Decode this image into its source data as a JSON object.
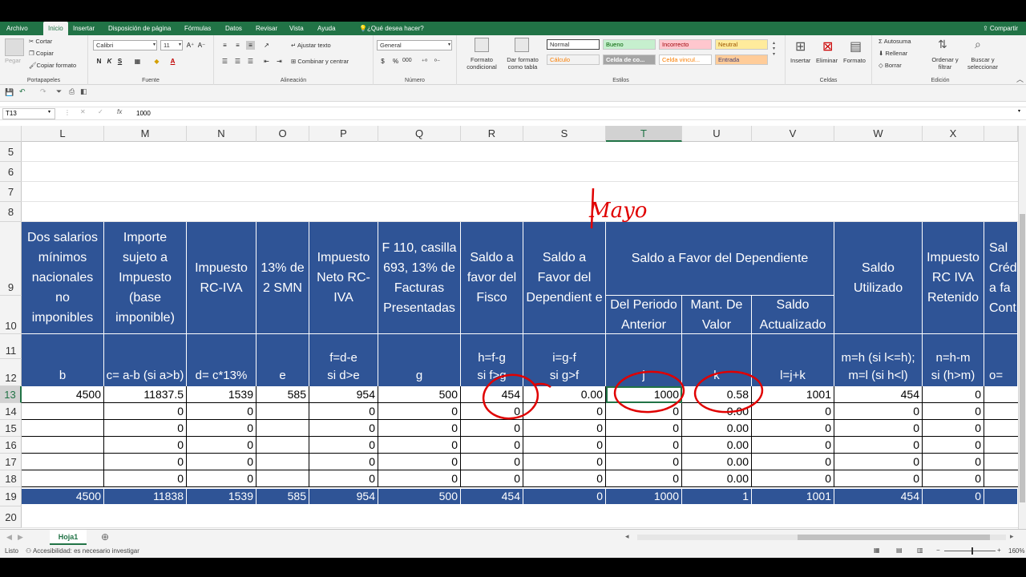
{
  "menu": {
    "tabs": [
      "Archivo",
      "Inicio",
      "Insertar",
      "Disposición de página",
      "Fórmulas",
      "Datos",
      "Revisar",
      "Vista",
      "Ayuda",
      "¿Qué desea hacer?"
    ],
    "share": "Compartir"
  },
  "ribbon": {
    "clipboard": {
      "paste": "Pegar",
      "cut": "Cortar",
      "copy": "Copiar",
      "format_painter": "Copiar formato",
      "label": "Portapapeles"
    },
    "font": {
      "name": "Calibri",
      "size": "11",
      "bold": "N",
      "italic": "K",
      "underline": "S",
      "label": "Fuente"
    },
    "alignment": {
      "wrap": "Ajustar texto",
      "merge": "Combinar y centrar",
      "label": "Alineación"
    },
    "number": {
      "format": "General",
      "label": "Número",
      "currency": "$",
      "percent": "%",
      "thousands": "000"
    },
    "styles": {
      "conditional": "Formato condicional",
      "as_table": "Dar formato como tabla",
      "cells": [
        "Normal",
        "Bueno",
        "Incorrecto",
        "Neutral",
        "Cálculo",
        "Celda de co...",
        "Celda vincul...",
        "Entrada"
      ],
      "label": "Estilos"
    },
    "cells": {
      "insert": "Insertar",
      "delete": "Eliminar",
      "format": "Formato",
      "label": "Celdas"
    },
    "editing": {
      "autosum": "Autosuma",
      "fill": "Rellenar",
      "clear": "Borrar",
      "sort": "Ordenar y filtrar",
      "find": "Buscar y seleccionar",
      "label": "Edición"
    }
  },
  "formula_bar": {
    "name_box": "T13",
    "value": "1000",
    "fx": "fx"
  },
  "columns": [
    "L",
    "M",
    "N",
    "O",
    "P",
    "Q",
    "R",
    "S",
    "T",
    "U",
    "V",
    "W",
    "X"
  ],
  "selected_column": "T",
  "rows": [
    "5",
    "6",
    "7",
    "8",
    "9",
    "10",
    "11",
    "12",
    "13",
    "14",
    "15",
    "16",
    "17",
    "18",
    "19",
    "20"
  ],
  "selected_row": "13",
  "annotation_text": "Mayo",
  "headers": {
    "L": "Dos salarios mínimos nacionales no imponibles",
    "M": "Importe sujeto a Impuesto (base imponible)",
    "N": "Impuesto RC-IVA",
    "O": "13% de 2 SMN",
    "P": "Impuesto Neto RC-IVA",
    "Q": "F 110, casilla 693, 13% de Facturas Presentadas",
    "R": "Saldo a favor del Fisco",
    "S": "Saldo a Favor del Dependient e",
    "TUV": "Saldo a Favor del Dependiente",
    "T": "Del Periodo Anterior",
    "U": "Mant. De Valor",
    "V": "Saldo Actualizado",
    "W": "Saldo Utilizado",
    "X": "Impuesto RC IVA Retenido",
    "Y": "Sal Créd a fa Cont"
  },
  "formulas": {
    "L": [
      "b"
    ],
    "M": [
      "c= a-b (si a>b)"
    ],
    "N": [
      "d= c*13%"
    ],
    "O": [
      "e"
    ],
    "P": [
      "f=d-e",
      "si d>e"
    ],
    "Q": [
      "g"
    ],
    "R": [
      "h=f-g",
      "si f>g"
    ],
    "S": [
      "i=g-f",
      "si g>f"
    ],
    "T": [
      "j"
    ],
    "U": [
      "k"
    ],
    "V": [
      "l=j+k"
    ],
    "W": [
      "m=h (si l<=h);",
      "m=l (si h<l)"
    ],
    "X": [
      "n=h-m",
      "si (h>m)"
    ],
    "Y": [
      "o="
    ]
  },
  "data_rows": [
    {
      "row": "13",
      "cells": [
        "4500",
        "11837.5",
        "1539",
        "585",
        "954",
        "500",
        "454",
        "0.00",
        "1000",
        "0.58",
        "1001",
        "454",
        "0"
      ]
    },
    {
      "row": "14",
      "cells": [
        "",
        "0",
        "0",
        "",
        "0",
        "0",
        "0",
        "0",
        "0",
        "0.00",
        "0",
        "0",
        "0"
      ]
    },
    {
      "row": "15",
      "cells": [
        "",
        "0",
        "0",
        "",
        "0",
        "0",
        "0",
        "0",
        "0",
        "0.00",
        "0",
        "0",
        "0"
      ]
    },
    {
      "row": "16",
      "cells": [
        "",
        "0",
        "0",
        "",
        "0",
        "0",
        "0",
        "0",
        "0",
        "0.00",
        "0",
        "0",
        "0"
      ]
    },
    {
      "row": "17",
      "cells": [
        "",
        "0",
        "0",
        "",
        "0",
        "0",
        "0",
        "0",
        "0",
        "0.00",
        "0",
        "0",
        "0"
      ]
    },
    {
      "row": "18",
      "cells": [
        "",
        "0",
        "0",
        "",
        "0",
        "0",
        "0",
        "0",
        "0",
        "0.00",
        "0",
        "0",
        "0"
      ]
    }
  ],
  "totals": {
    "row": "19",
    "cells": [
      "4500",
      "11838",
      "1539",
      "585",
      "954",
      "500",
      "454",
      "0",
      "1000",
      "1",
      "1001",
      "454",
      "0"
    ]
  },
  "sheet_tab": "Hoja1",
  "status": {
    "mode": "Listo",
    "accessibility": "Accesibilidad: es necesario investigar",
    "zoom": "160%"
  },
  "colors": {
    "header_blue": "#2f5496",
    "excel_green": "#217346",
    "annotation_red": "#e00000"
  }
}
